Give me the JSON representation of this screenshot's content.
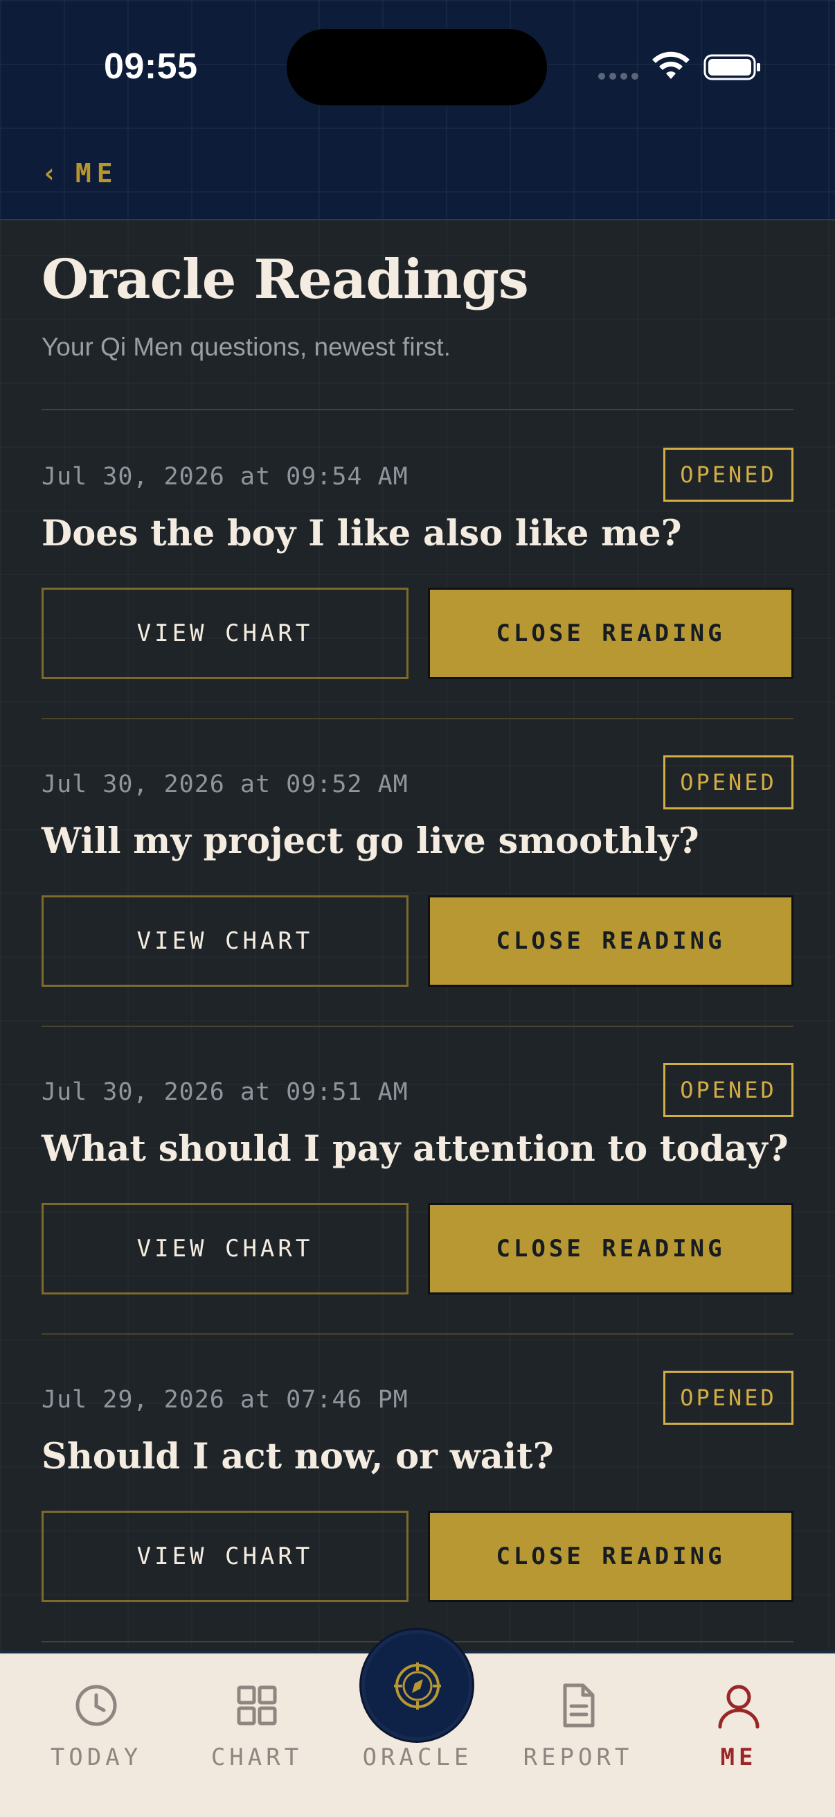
{
  "status_bar": {
    "time": "09:55"
  },
  "header": {
    "back_label": "ME"
  },
  "page": {
    "title": "Oracle Readings",
    "subtitle": "Your Qi Men questions, newest first."
  },
  "readings": [
    {
      "date": "Jul 30, 2026 at 09:54 AM",
      "status": "OPENED",
      "question": "Does the boy I like also like me?",
      "view_label": "VIEW CHART",
      "close_label": "CLOSE READING"
    },
    {
      "date": "Jul 30, 2026 at 09:52 AM",
      "status": "OPENED",
      "question": "Will my project go live smoothly?",
      "view_label": "VIEW CHART",
      "close_label": "CLOSE READING"
    },
    {
      "date": "Jul 30, 2026 at 09:51 AM",
      "status": "OPENED",
      "question": "What should I pay attention to today?",
      "view_label": "VIEW CHART",
      "close_label": "CLOSE READING"
    },
    {
      "date": "Jul 29, 2026 at 07:46 PM",
      "status": "OPENED",
      "question": "Should I act now, or wait?",
      "view_label": "VIEW CHART",
      "close_label": "CLOSE READING"
    }
  ],
  "tab_bar": {
    "items": [
      {
        "label": "TODAY",
        "icon": "clock-icon"
      },
      {
        "label": "CHART",
        "icon": "grid-icon"
      },
      {
        "label": "ORACLE",
        "icon": "compass-icon"
      },
      {
        "label": "REPORT",
        "icon": "document-icon"
      },
      {
        "label": "ME",
        "icon": "person-icon",
        "active": true
      }
    ]
  },
  "colors": {
    "header_bg": "#0d1c38",
    "page_bg": "#1f2428",
    "accent_gold": "#b89832",
    "text_cream": "#f4ece0",
    "active_tab": "#9a2626",
    "tab_bar_bg": "#f2e9de"
  }
}
